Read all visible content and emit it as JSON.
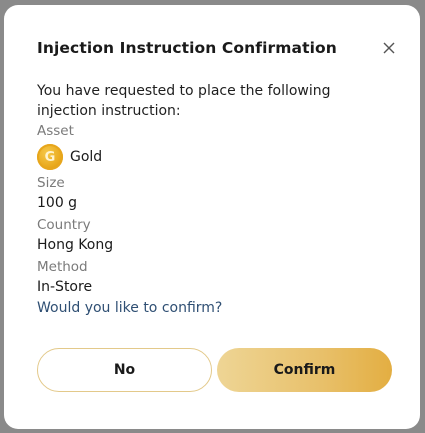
{
  "dialog": {
    "title": "Injection Instruction Confirmation",
    "intro": "You have requested to place the following injection instruction:",
    "asset_label": "Asset",
    "asset_value": "Gold",
    "asset_icon": "gold-coin-icon",
    "asset_icon_letter": "G",
    "size_label": "Size",
    "size_value": "100 g",
    "country_label": "Country",
    "country_value": "Hong Kong",
    "method_label": "Method",
    "method_value": "In-Store",
    "question": "Would you like to confirm?",
    "no_label": "No",
    "confirm_label": "Confirm"
  },
  "colors": {
    "accent_gold": "#e8c06a",
    "question_text": "#2f4f73",
    "coin": "#e9a91c"
  }
}
